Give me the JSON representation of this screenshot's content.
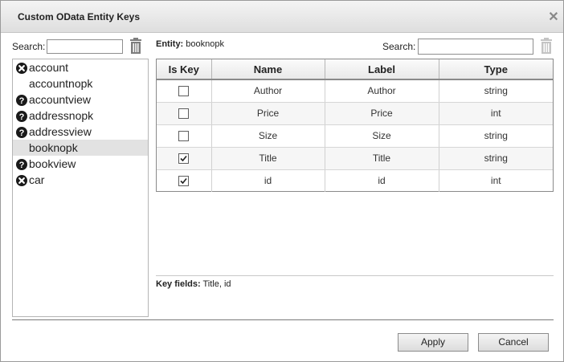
{
  "dialog": {
    "title": "Custom OData Entity Keys",
    "close_glyph": "✕"
  },
  "left_panel": {
    "search_label": "Search:",
    "search_value": "",
    "entities": [
      {
        "name": "account",
        "icon": "cross-circle-icon",
        "selected": false
      },
      {
        "name": "accountnopk",
        "icon": "none",
        "selected": false
      },
      {
        "name": "accountview",
        "icon": "question-circle-icon",
        "selected": false
      },
      {
        "name": "addressnopk",
        "icon": "question-circle-icon",
        "selected": false
      },
      {
        "name": "addressview",
        "icon": "question-circle-icon",
        "selected": false
      },
      {
        "name": "booknopk",
        "icon": "none",
        "selected": true
      },
      {
        "name": "bookview",
        "icon": "question-circle-icon",
        "selected": false
      },
      {
        "name": "car",
        "icon": "cross-circle-icon",
        "selected": false
      }
    ]
  },
  "right_panel": {
    "entity_label": "Entity:",
    "entity_name": "booknopk",
    "search_label": "Search:",
    "search_value": "",
    "columns": [
      "Is Key",
      "Name",
      "Label",
      "Type"
    ],
    "rows": [
      {
        "is_key": false,
        "name": "Author",
        "label": "Author",
        "type": "string"
      },
      {
        "is_key": false,
        "name": "Price",
        "label": "Price",
        "type": "int"
      },
      {
        "is_key": false,
        "name": "Size",
        "label": "Size",
        "type": "string"
      },
      {
        "is_key": true,
        "name": "Title",
        "label": "Title",
        "type": "string"
      },
      {
        "is_key": true,
        "name": "id",
        "label": "id",
        "type": "int"
      }
    ],
    "key_fields_label": "Key fields:",
    "key_fields_value": "Title, id"
  },
  "footer": {
    "apply_label": "Apply",
    "cancel_label": "Cancel"
  },
  "colors": {
    "icon_dark": "#1a1a1a",
    "trash_gray": "#7d7d7d",
    "selected_row": "#e2e2e2"
  }
}
